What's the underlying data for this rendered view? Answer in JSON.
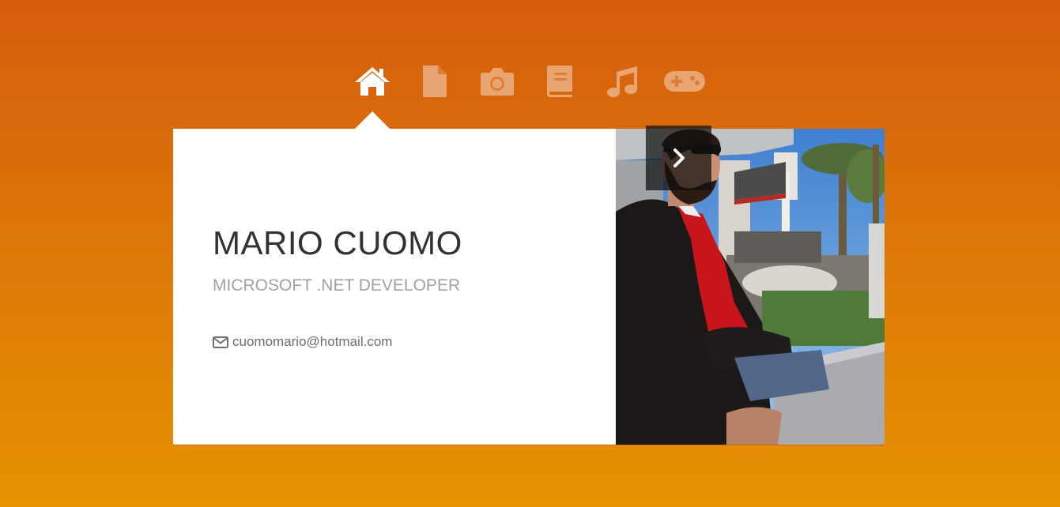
{
  "nav": {
    "items": [
      {
        "icon": "home-icon",
        "active": true
      },
      {
        "icon": "document-icon",
        "active": false
      },
      {
        "icon": "camera-icon",
        "active": false
      },
      {
        "icon": "book-icon",
        "active": false
      },
      {
        "icon": "music-icon",
        "active": false
      },
      {
        "icon": "gamepad-icon",
        "active": false
      }
    ]
  },
  "profile": {
    "name": "MARIO CUOMO",
    "title": "MICROSOFT .NET DEVELOPER",
    "email": "cuomomario@hotmail.com",
    "email_icon": "envelope-icon"
  },
  "photo": {
    "next_icon": "chevron-right-icon"
  },
  "colors": {
    "background_top": "#d65c0e",
    "background_bottom": "#e79201",
    "card": "#ffffff",
    "name_text": "#2f3338",
    "subtitle_text": "#9fa2a6"
  }
}
